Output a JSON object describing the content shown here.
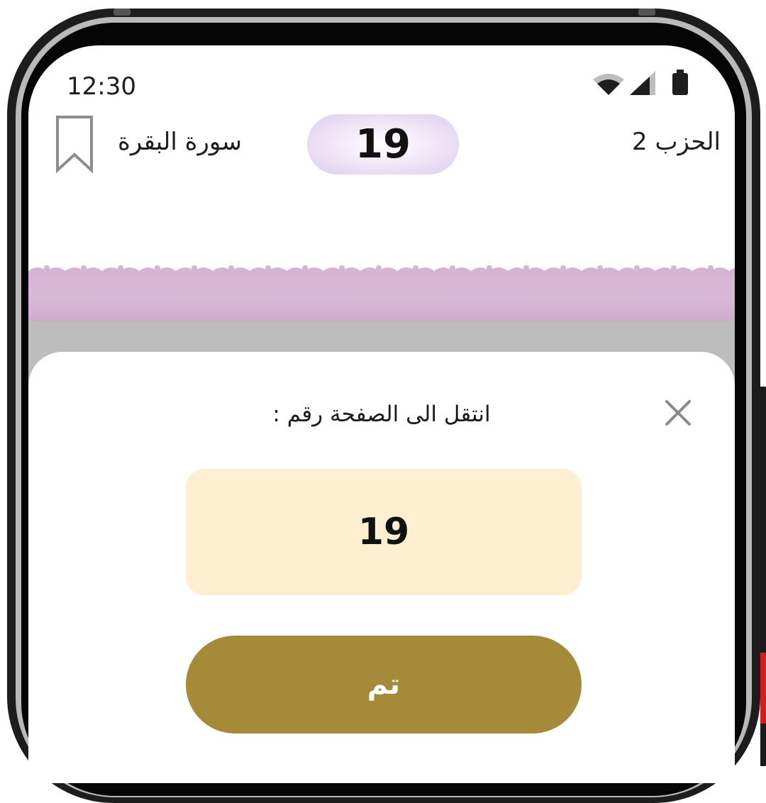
{
  "status_bar": {
    "time": "12:30",
    "icons": [
      "wifi-icon",
      "cell-signal-icon",
      "battery-icon"
    ]
  },
  "header": {
    "surah_name": "سورة البقرة",
    "page_number": "19",
    "hizb": "الحزب 2",
    "bookmark_icon": "bookmark-icon"
  },
  "colors": {
    "ornament": "#d6b2d3",
    "page_pill": "#dccdee",
    "input_background": "#fdefcf",
    "done_button": "#a58a3a"
  },
  "goto_sheet": {
    "title": "انتقل الى الصفحة رقم :",
    "page_value": "19",
    "done_label": "تم",
    "close_icon": "close-icon"
  }
}
